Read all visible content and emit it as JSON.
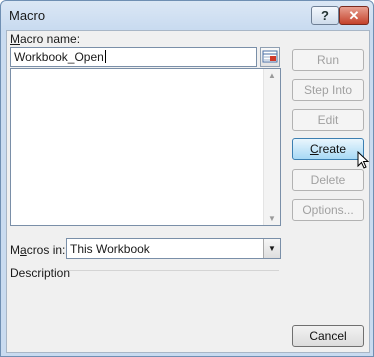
{
  "window": {
    "title": "Macro"
  },
  "titlebar": {
    "help_label": "?",
    "close_label": "✕"
  },
  "form": {
    "macro_name_label_m": "M",
    "macro_name_label_rest": "acro name:",
    "macro_name_value": "Workbook_Open",
    "macros_in_label_a": "M",
    "macros_in_label_u": "a",
    "macros_in_label_rest": "cros in:",
    "macros_in_value": "This Workbook",
    "description_label": "Description"
  },
  "buttons": {
    "run": "Run",
    "step_into": "Step Into",
    "edit": "Edit",
    "create_first": "C",
    "create_rest": "reate",
    "delete": "Delete",
    "options": "Options...",
    "cancel": "Cancel"
  },
  "colors": {
    "title_bar": "#c9dbf0",
    "create_highlight": "#a7d9f5",
    "disabled_text": "#a1a1a1"
  }
}
